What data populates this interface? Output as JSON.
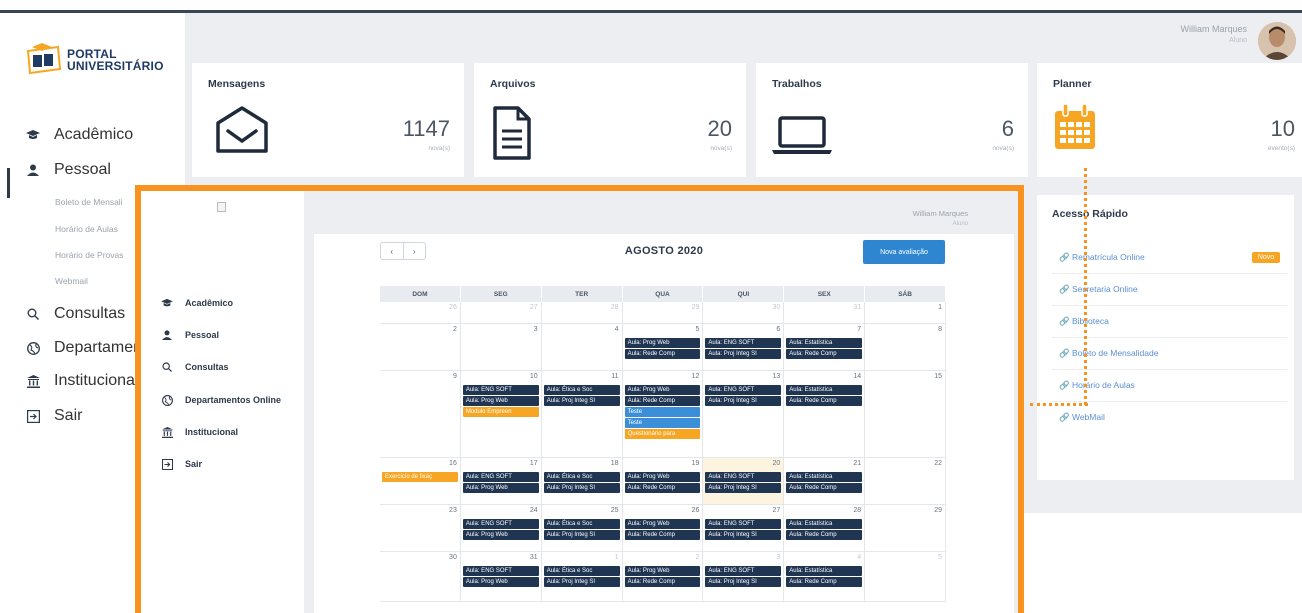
{
  "app": {
    "logo_line1": "PORTAL",
    "logo_line2": "UNIVERSITÁRIO"
  },
  "user": {
    "name": "William Marques",
    "role": "Aluno"
  },
  "sidebar": {
    "items": [
      {
        "label": "Acadêmico",
        "icon": "graduation-cap-icon"
      },
      {
        "label": "Pessoal",
        "icon": "user-icon"
      },
      {
        "label": "Consultas",
        "icon": "search-icon"
      },
      {
        "label": "Departamentos",
        "icon": "globe-icon"
      },
      {
        "label": "Institucional",
        "icon": "institution-icon"
      },
      {
        "label": "Sair",
        "icon": "sign-out-icon"
      }
    ],
    "subitems": [
      "Boleto de Mensali",
      "Horário de Aulas",
      "Horário de Provas",
      "Webmail"
    ]
  },
  "cards": [
    {
      "title": "Mensagens",
      "value": "1147",
      "unit": "nova(s)",
      "icon": "envelope-icon"
    },
    {
      "title": "Arquivos",
      "value": "20",
      "unit": "nova(s)",
      "icon": "document-icon"
    },
    {
      "title": "Trabalhos",
      "value": "6",
      "unit": "nova(s)",
      "icon": "laptop-icon"
    },
    {
      "title": "Planner",
      "value": "10",
      "unit": "evento(s)",
      "icon": "calendar-icon"
    }
  ],
  "quick_access": {
    "title": "Acesso Rápido",
    "badge": "Novo",
    "links": [
      "Rematrícula Online",
      "Secretaria Online",
      "Biblioteca",
      "Boleto de Mensalidade",
      "Horário de Aulas",
      "WebMail"
    ]
  },
  "overlay": {
    "user_name": "William Marques",
    "user_role": "Aluno",
    "nav": [
      {
        "label": "Acadêmico",
        "icon": "graduation-cap-icon"
      },
      {
        "label": "Pessoal",
        "icon": "user-icon"
      },
      {
        "label": "Consultas",
        "icon": "search-icon"
      },
      {
        "label": "Departamentos Online",
        "icon": "globe-icon"
      },
      {
        "label": "Institucional",
        "icon": "institution-icon"
      },
      {
        "label": "Sair",
        "icon": "sign-out-icon"
      }
    ],
    "calendar": {
      "month": "AGOSTO 2020",
      "prev": "‹",
      "next": "›",
      "new_button": "Nova avaliação",
      "weekdays": [
        "DOM",
        "SEG",
        "TER",
        "QUA",
        "QUI",
        "SEX",
        "SÁB"
      ],
      "weeks": [
        [
          {
            "d": "26",
            "o": true
          },
          {
            "d": "27",
            "o": true
          },
          {
            "d": "28",
            "o": true
          },
          {
            "d": "29",
            "o": true
          },
          {
            "d": "30",
            "o": true
          },
          {
            "d": "31",
            "o": true
          },
          {
            "d": "1"
          }
        ],
        [
          {
            "d": "2"
          },
          {
            "d": "3"
          },
          {
            "d": "4"
          },
          {
            "d": "5",
            "ev": [
              [
                "Aula: Prog Web",
                ""
              ],
              [
                "Aula: Rede Comp",
                ""
              ]
            ]
          },
          {
            "d": "6",
            "ev": [
              [
                "Aula: ENG SOFT",
                ""
              ],
              [
                "Aula: Proj Integ SI",
                ""
              ]
            ]
          },
          {
            "d": "7",
            "ev": [
              [
                "Aula: Estatística",
                ""
              ],
              [
                "Aula: Rede Comp",
                ""
              ]
            ]
          },
          {
            "d": "8"
          }
        ],
        [
          {
            "d": "9"
          },
          {
            "d": "10",
            "ev": [
              [
                "Aula: ENG SOFT",
                ""
              ],
              [
                "Aula: Prog Web",
                ""
              ],
              [
                "Modulo Empreen",
                "orange"
              ]
            ]
          },
          {
            "d": "11",
            "ev": [
              [
                "Aula: Ética e Soc",
                ""
              ],
              [
                "Aula: Proj Integ SI",
                ""
              ]
            ]
          },
          {
            "d": "12",
            "ev": [
              [
                "Aula: Prog Web",
                ""
              ],
              [
                "Aula: Rede Comp",
                ""
              ],
              [
                "Teste",
                "blue"
              ],
              [
                "Teste",
                "blue"
              ],
              [
                "Questionário para",
                "orange"
              ]
            ]
          },
          {
            "d": "13",
            "ev": [
              [
                "Aula: ENG SOFT",
                ""
              ],
              [
                "Aula: Proj Integ SI",
                ""
              ]
            ]
          },
          {
            "d": "14",
            "ev": [
              [
                "Aula: Estatística",
                ""
              ],
              [
                "Aula: Rede Comp",
                ""
              ]
            ]
          },
          {
            "d": "15"
          }
        ],
        [
          {
            "d": "16",
            "ev": [
              [
                "Exercício de fixaç",
                "orange"
              ]
            ]
          },
          {
            "d": "17",
            "ev": [
              [
                "Aula: ENG SOFT",
                ""
              ],
              [
                "Aula: Prog Web",
                ""
              ]
            ]
          },
          {
            "d": "18",
            "ev": [
              [
                "Aula: Ética e Soc",
                ""
              ],
              [
                "Aula: Proj Integ SI",
                ""
              ]
            ]
          },
          {
            "d": "19",
            "ev": [
              [
                "Aula: Prog Web",
                ""
              ],
              [
                "Aula: Rede Comp",
                ""
              ]
            ]
          },
          {
            "d": "20",
            "today": true,
            "ev": [
              [
                "Aula: ENG SOFT",
                ""
              ],
              [
                "Aula: Proj Integ SI",
                ""
              ]
            ]
          },
          {
            "d": "21",
            "ev": [
              [
                "Aula: Estatística",
                ""
              ],
              [
                "Aula: Rede Comp",
                ""
              ]
            ]
          },
          {
            "d": "22"
          }
        ],
        [
          {
            "d": "23"
          },
          {
            "d": "24",
            "ev": [
              [
                "Aula: ENG SOFT",
                ""
              ],
              [
                "Aula: Prog Web",
                ""
              ]
            ]
          },
          {
            "d": "25",
            "ev": [
              [
                "Aula: Ética e Soc",
                ""
              ],
              [
                "Aula: Proj Integ SI",
                ""
              ]
            ]
          },
          {
            "d": "26",
            "ev": [
              [
                "Aula: Prog Web",
                ""
              ],
              [
                "Aula: Rede Comp",
                ""
              ]
            ]
          },
          {
            "d": "27",
            "ev": [
              [
                "Aula: ENG SOFT",
                ""
              ],
              [
                "Aula: Proj Integ SI",
                ""
              ]
            ]
          },
          {
            "d": "28",
            "ev": [
              [
                "Aula: Estatística",
                ""
              ],
              [
                "Aula: Rede Comp",
                ""
              ]
            ]
          },
          {
            "d": "29"
          }
        ],
        [
          {
            "d": "30"
          },
          {
            "d": "31",
            "ev": [
              [
                "Aula: ENG SOFT",
                ""
              ],
              [
                "Aula: Prog Web",
                ""
              ]
            ]
          },
          {
            "d": "1",
            "o": true,
            "ev": [
              [
                "Aula: Ética e Soc",
                ""
              ],
              [
                "Aula: Proj Integ SI",
                ""
              ]
            ]
          },
          {
            "d": "2",
            "o": true,
            "ev": [
              [
                "Aula: Prog Web",
                ""
              ],
              [
                "Aula: Rede Comp",
                ""
              ]
            ]
          },
          {
            "d": "3",
            "o": true,
            "ev": [
              [
                "Aula: ENG SOFT",
                ""
              ],
              [
                "Aula: Proj Integ SI",
                ""
              ]
            ]
          },
          {
            "d": "4",
            "o": true,
            "ev": [
              [
                "Aula: Estatística",
                ""
              ],
              [
                "Aula: Rede Comp",
                ""
              ]
            ]
          },
          {
            "d": "5",
            "o": true
          }
        ]
      ]
    }
  },
  "colors": {
    "accent": "#f7931e",
    "navy": "#1f3552",
    "blue": "#2f86d0",
    "orange_event": "#f6a623"
  }
}
